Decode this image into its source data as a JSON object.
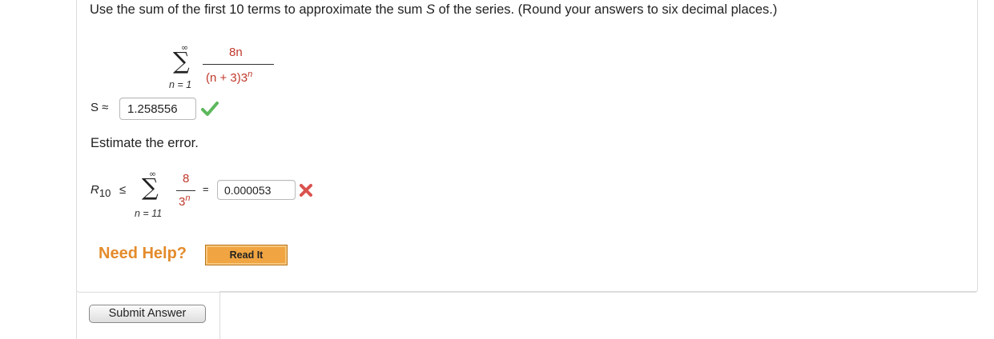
{
  "question": {
    "text_before_s": "Use the sum of the first 10 terms to approximate the sum ",
    "s_symbol": "S",
    "text_after_s": " of the series. (Round your answers to six decimal places.)"
  },
  "series1": {
    "upper": "∞",
    "lower": "n = 1",
    "numerator": "8n",
    "denominator_prefix": "(n + 3)3",
    "denominator_exp": "n"
  },
  "s_approx": {
    "label": "S ≈",
    "value": "1.258556",
    "status": "correct"
  },
  "estimate": {
    "label": "Estimate the error."
  },
  "error_bound": {
    "r_symbol": "R",
    "r_subscript": "10",
    "leq": "≤",
    "upper": "∞",
    "lower": "n = 11",
    "numerator": "8",
    "denominator_base": "3",
    "denominator_exp": "n",
    "equals": "=",
    "value": "0.000053",
    "status": "incorrect"
  },
  "help": {
    "need_help": "Need Help?",
    "read_it": "Read It"
  },
  "submit": {
    "label": "Submit Answer"
  },
  "colors": {
    "correct": "#5cb85c",
    "incorrect": "#d9534f",
    "help_orange": "#e48b2b",
    "button_orange": "#f0a542",
    "math_red": "#c0392b"
  }
}
